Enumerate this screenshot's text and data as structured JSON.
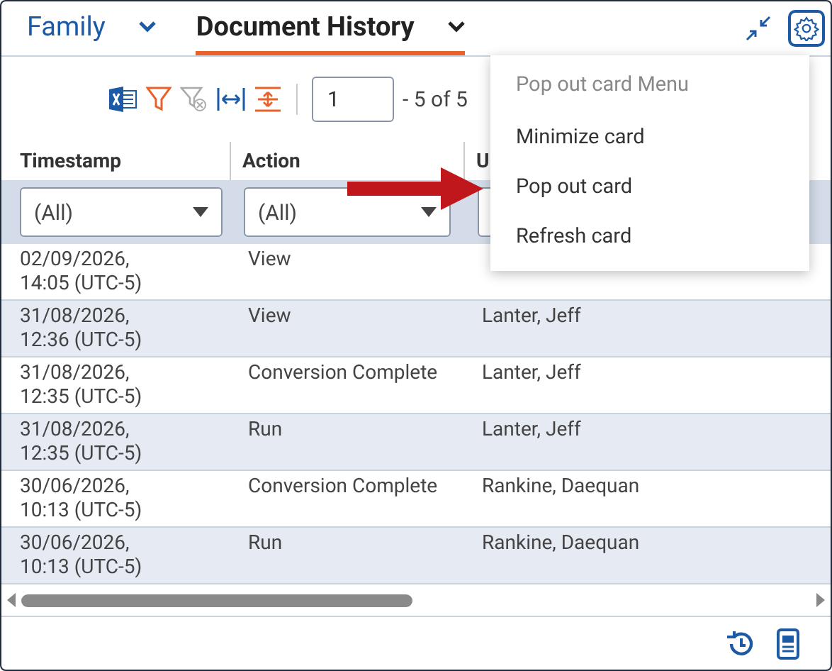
{
  "tabs": [
    {
      "label": "Family",
      "selected": false
    },
    {
      "label": "Document History",
      "selected": true
    }
  ],
  "toolbar": {
    "page": "1",
    "range": "- 5 of 5"
  },
  "table": {
    "columns": [
      {
        "label": "Timestamp",
        "filter": "(All)"
      },
      {
        "label": "Action",
        "filter": "(All)"
      },
      {
        "label": "U"
      }
    ],
    "rows": [
      {
        "cells": [
          "02/09/2026, 14:05 (UTC-5)",
          "View"
        ]
      },
      {
        "cells": [
          "31/08/2026, 12:36 (UTC-5)",
          "View",
          "Lanter, Jeff"
        ]
      },
      {
        "cells": [
          "31/08/2026, 12:35 (UTC-5)",
          "Conversion Complete",
          "Lanter, Jeff"
        ]
      },
      {
        "cells": [
          "31/08/2026, 12:35 (UTC-5)",
          "Run",
          "Lanter, Jeff"
        ]
      },
      {
        "cells": [
          "30/06/2026, 10:13 (UTC-5)",
          "Conversion Complete",
          "Rankine, Daequan"
        ]
      },
      {
        "cells": [
          "30/06/2026, 10:13 (UTC-5)",
          "Run",
          "Rankine, Daequan"
        ]
      }
    ]
  },
  "menu": {
    "title": "Pop out card Menu",
    "items": [
      "Minimize card",
      "Pop out card",
      "Refresh card"
    ]
  }
}
